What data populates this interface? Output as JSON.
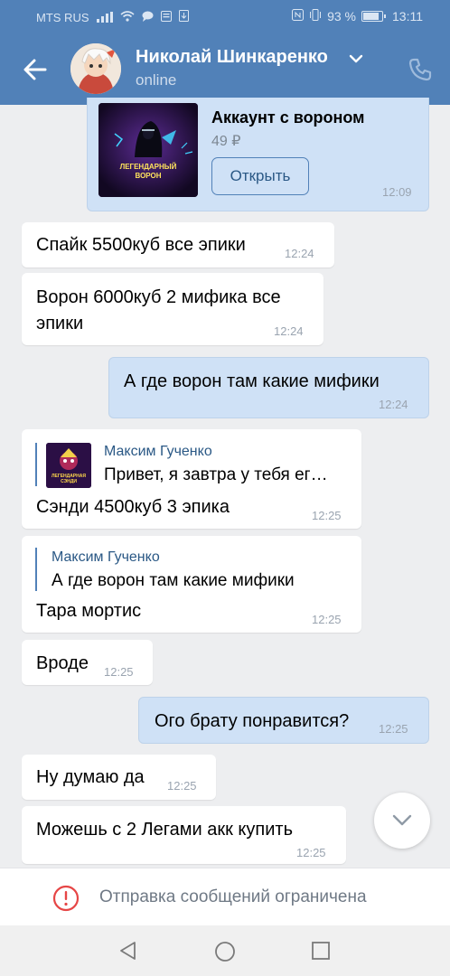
{
  "status_bar": {
    "carrier": "MTS RUS",
    "battery": "93 %",
    "time": "13:11"
  },
  "header": {
    "contact_name": "Николай Шинкаренко",
    "status": "online",
    "icons": [
      "back-arrow-icon",
      "chevron-down-icon",
      "phone-icon"
    ]
  },
  "messages": [
    {
      "type": "product",
      "direction": "out",
      "title": "Аккаунт с вороном",
      "price": "49 ₽",
      "image_caption": "ЛЕГЕНДАРНЫЙ ВОРОН",
      "button": "Открыть",
      "time": "12:09"
    },
    {
      "direction": "in",
      "text": "Спайк 5500куб все эпики",
      "time": "12:24"
    },
    {
      "direction": "in",
      "text_line1": "Ворон 6000куб 2 мифика все",
      "text_line2": "эпики",
      "time": "12:24"
    },
    {
      "direction": "out",
      "text": "А где ворон там какие мифики",
      "time": "12:24"
    },
    {
      "direction": "in",
      "quote_author": "Максим Гученко",
      "quote_text": "Привет, я завтра у тебя ег…",
      "quote_thumb_caption": "ЛЕГЕНДАРНАЯ СЭНДИ",
      "text": "Сэнди 4500куб 3 эпика",
      "time": "12:25"
    },
    {
      "direction": "in",
      "quote_author": "Максим Гученко",
      "quote_text": "А где ворон там какие мифики",
      "text": "Тара мортис",
      "time": "12:25"
    },
    {
      "direction": "in",
      "text": "Вроде",
      "time": "12:25"
    },
    {
      "direction": "out",
      "text": "Ого брату понравится?",
      "time": "12:25"
    },
    {
      "direction": "in",
      "text": "Ну думаю да",
      "time": "12:25"
    },
    {
      "direction": "in",
      "text": "Можешь с 2 Легами акк купить",
      "time": "12:25"
    }
  ],
  "notice": {
    "text": "Отправка сообщений ограничена",
    "icon": "warning-circle-icon"
  },
  "nav": [
    "back-triangle-icon",
    "home-circle-icon",
    "recents-square-icon"
  ],
  "colors": {
    "header": "#5181b8",
    "outgoing_bubble": "#cfe1f6",
    "incoming_bubble": "#ffffff",
    "link": "#2a5885",
    "background": "#edeef0"
  }
}
